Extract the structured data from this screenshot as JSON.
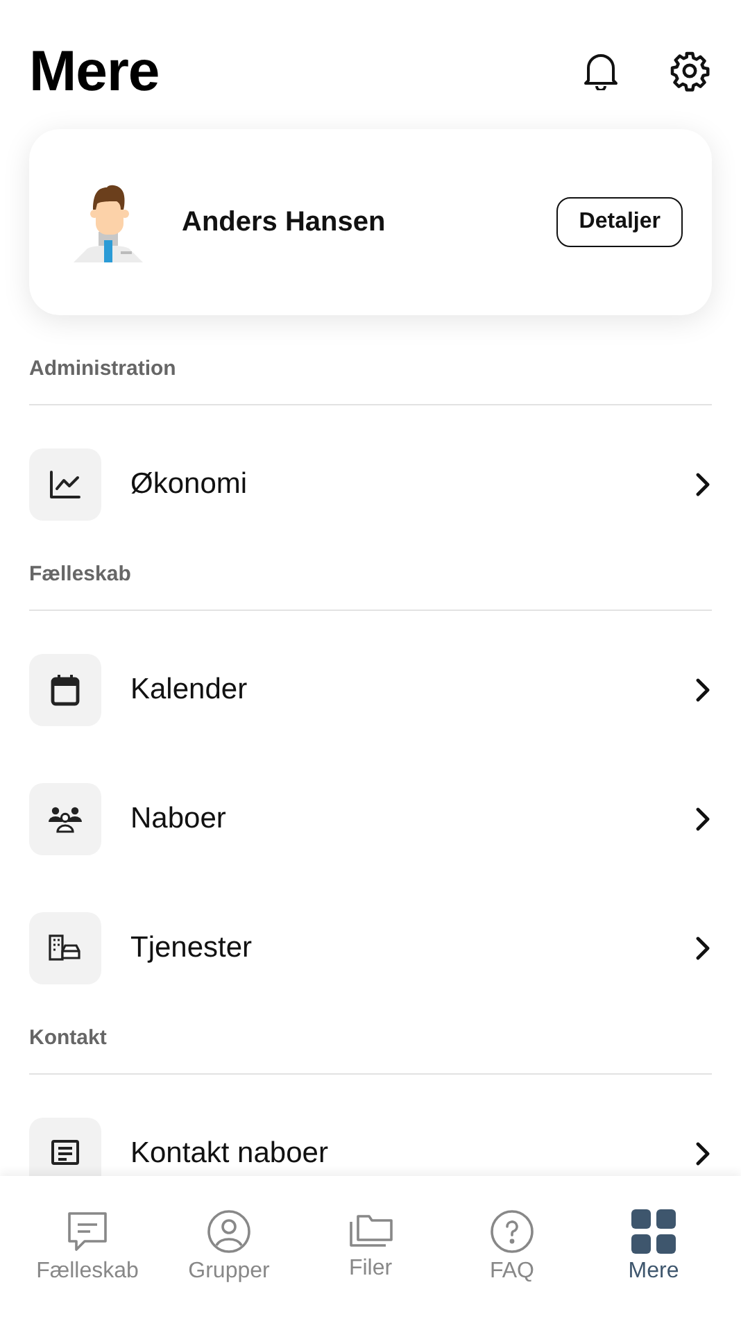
{
  "header": {
    "title": "Mere"
  },
  "profile": {
    "name": "Anders Hansen",
    "button": "Detaljer"
  },
  "sections": [
    {
      "title": "Administration",
      "items": [
        {
          "label": "Økonomi"
        }
      ]
    },
    {
      "title": "Fælleskab",
      "items": [
        {
          "label": "Kalender"
        },
        {
          "label": "Naboer"
        },
        {
          "label": "Tjenester"
        }
      ]
    },
    {
      "title": "Kontakt",
      "items": [
        {
          "label": "Kontakt naboer"
        }
      ]
    }
  ],
  "tab_bar": [
    {
      "label": "Fælleskab",
      "selected": false
    },
    {
      "label": "Grupper",
      "selected": false
    },
    {
      "label": "Filer",
      "selected": false
    },
    {
      "label": "FAQ",
      "selected": false
    },
    {
      "label": "Mere",
      "selected": true
    }
  ]
}
